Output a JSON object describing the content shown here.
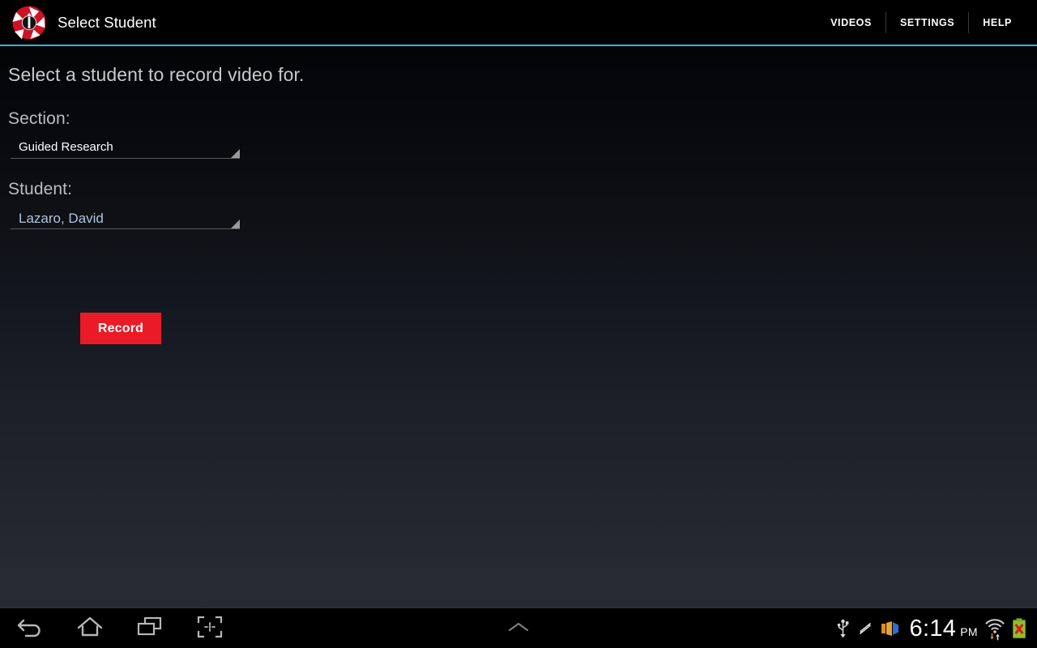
{
  "app": {
    "title": "Select Student",
    "logo_icon": "camera-aperture-logo",
    "accent_color": "#33b5e5",
    "record_color": "#ea1b26"
  },
  "actionbar": {
    "menu": [
      {
        "label": "VIDEOS",
        "name": "videos"
      },
      {
        "label": "SETTINGS",
        "name": "settings"
      },
      {
        "label": "HELP",
        "name": "help"
      }
    ]
  },
  "main": {
    "headline": "Select a student to record video for.",
    "section": {
      "label": "Section:",
      "value": "Guided Research",
      "caret_icon": "dropdown-triangle-icon"
    },
    "student": {
      "label": "Student:",
      "value": "Lazaro,  David",
      "caret_icon": "dropdown-triangle-icon"
    },
    "record_label": "Record"
  },
  "sysbar": {
    "nav": [
      {
        "name": "back",
        "icon": "back-arrow-icon"
      },
      {
        "name": "home",
        "icon": "home-icon"
      },
      {
        "name": "recents",
        "icon": "recent-apps-icon"
      },
      {
        "name": "screenshot",
        "icon": "screenshot-icon"
      }
    ],
    "notifications_icon": "chevron-up-icon",
    "status_icons": [
      {
        "name": "usb",
        "icon": "usb-icon"
      },
      {
        "name": "adb-debug",
        "icon": "debug-arrows-icon"
      },
      {
        "name": "cast",
        "icon": "cast-projector-icon"
      }
    ],
    "clock": {
      "time": "6:14",
      "ampm": "PM"
    },
    "wifi_icon": "wifi-signal-icon",
    "battery_icon": "battery-error-icon"
  }
}
